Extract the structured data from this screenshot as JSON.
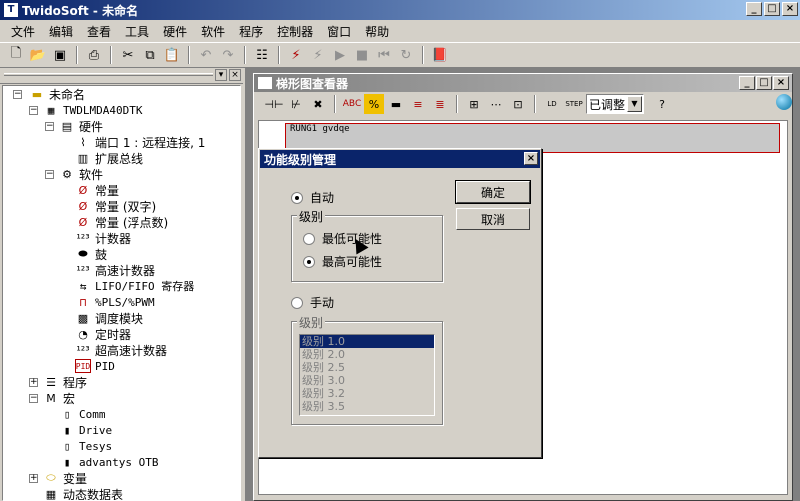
{
  "app": {
    "title": "TwidoSoft - 未命名",
    "icon": "app-icon"
  },
  "window_buttons": [
    "_",
    "□",
    "×"
  ],
  "menu": [
    "文件",
    "编辑",
    "查看",
    "工具",
    "硬件",
    "软件",
    "程序",
    "控制器",
    "窗口",
    "帮助"
  ],
  "toolbar": {
    "icons": [
      "new-icon",
      "open-icon",
      "save-icon",
      "print-icon",
      "cut-icon",
      "copy-icon",
      "paste-icon",
      "undo-icon",
      "redo-icon",
      "analyze-icon",
      "connect-icon",
      "disconnect-icon",
      "run-icon",
      "stop-icon",
      "init-icon",
      "refresh-icon",
      "help-book-icon"
    ]
  },
  "tree": {
    "root": "未命名",
    "controller": "TWDLMDA40DTK",
    "hardware": "硬件",
    "port1": "端口 1 : 远程连接, 1",
    "expansion": "扩展总线",
    "software": "软件",
    "const": "常量",
    "const_dword": "常量 (双字)",
    "const_float": "常量 (浮点数)",
    "counters": "计数器",
    "drums": "鼓",
    "fast_counters": "高速计数器",
    "lifo": "LIFO/FIFO 寄存器",
    "pls": "%PLS/%PWM",
    "schedule": "调度模块",
    "timers": "定时器",
    "vfc": "超高速计数器",
    "pid": "PID",
    "program": "程序",
    "macro": "宏",
    "comm": "Comm",
    "drive": "Drive",
    "tesys": "Tesys",
    "advantys": "advantys OTB",
    "variables": "变量",
    "dynamic_table": "动态数据表"
  },
  "ladder": {
    "title": "梯形图查看器",
    "combo_value": "已调整",
    "rung_text": "RUNG1   gvdqe"
  },
  "dialog": {
    "title": "功能级别管理",
    "close": "×",
    "auto": "自动",
    "group1": "级别",
    "lowest": "最低可能性",
    "highest": "最高可能性",
    "manual": "手动",
    "group2": "级别",
    "ok": "确定",
    "cancel": "取消",
    "levels": [
      "级别 1.0",
      "级别 2.0",
      "级别 2.5",
      "级别 3.0",
      "级别 3.2",
      "级别 3.5"
    ]
  }
}
